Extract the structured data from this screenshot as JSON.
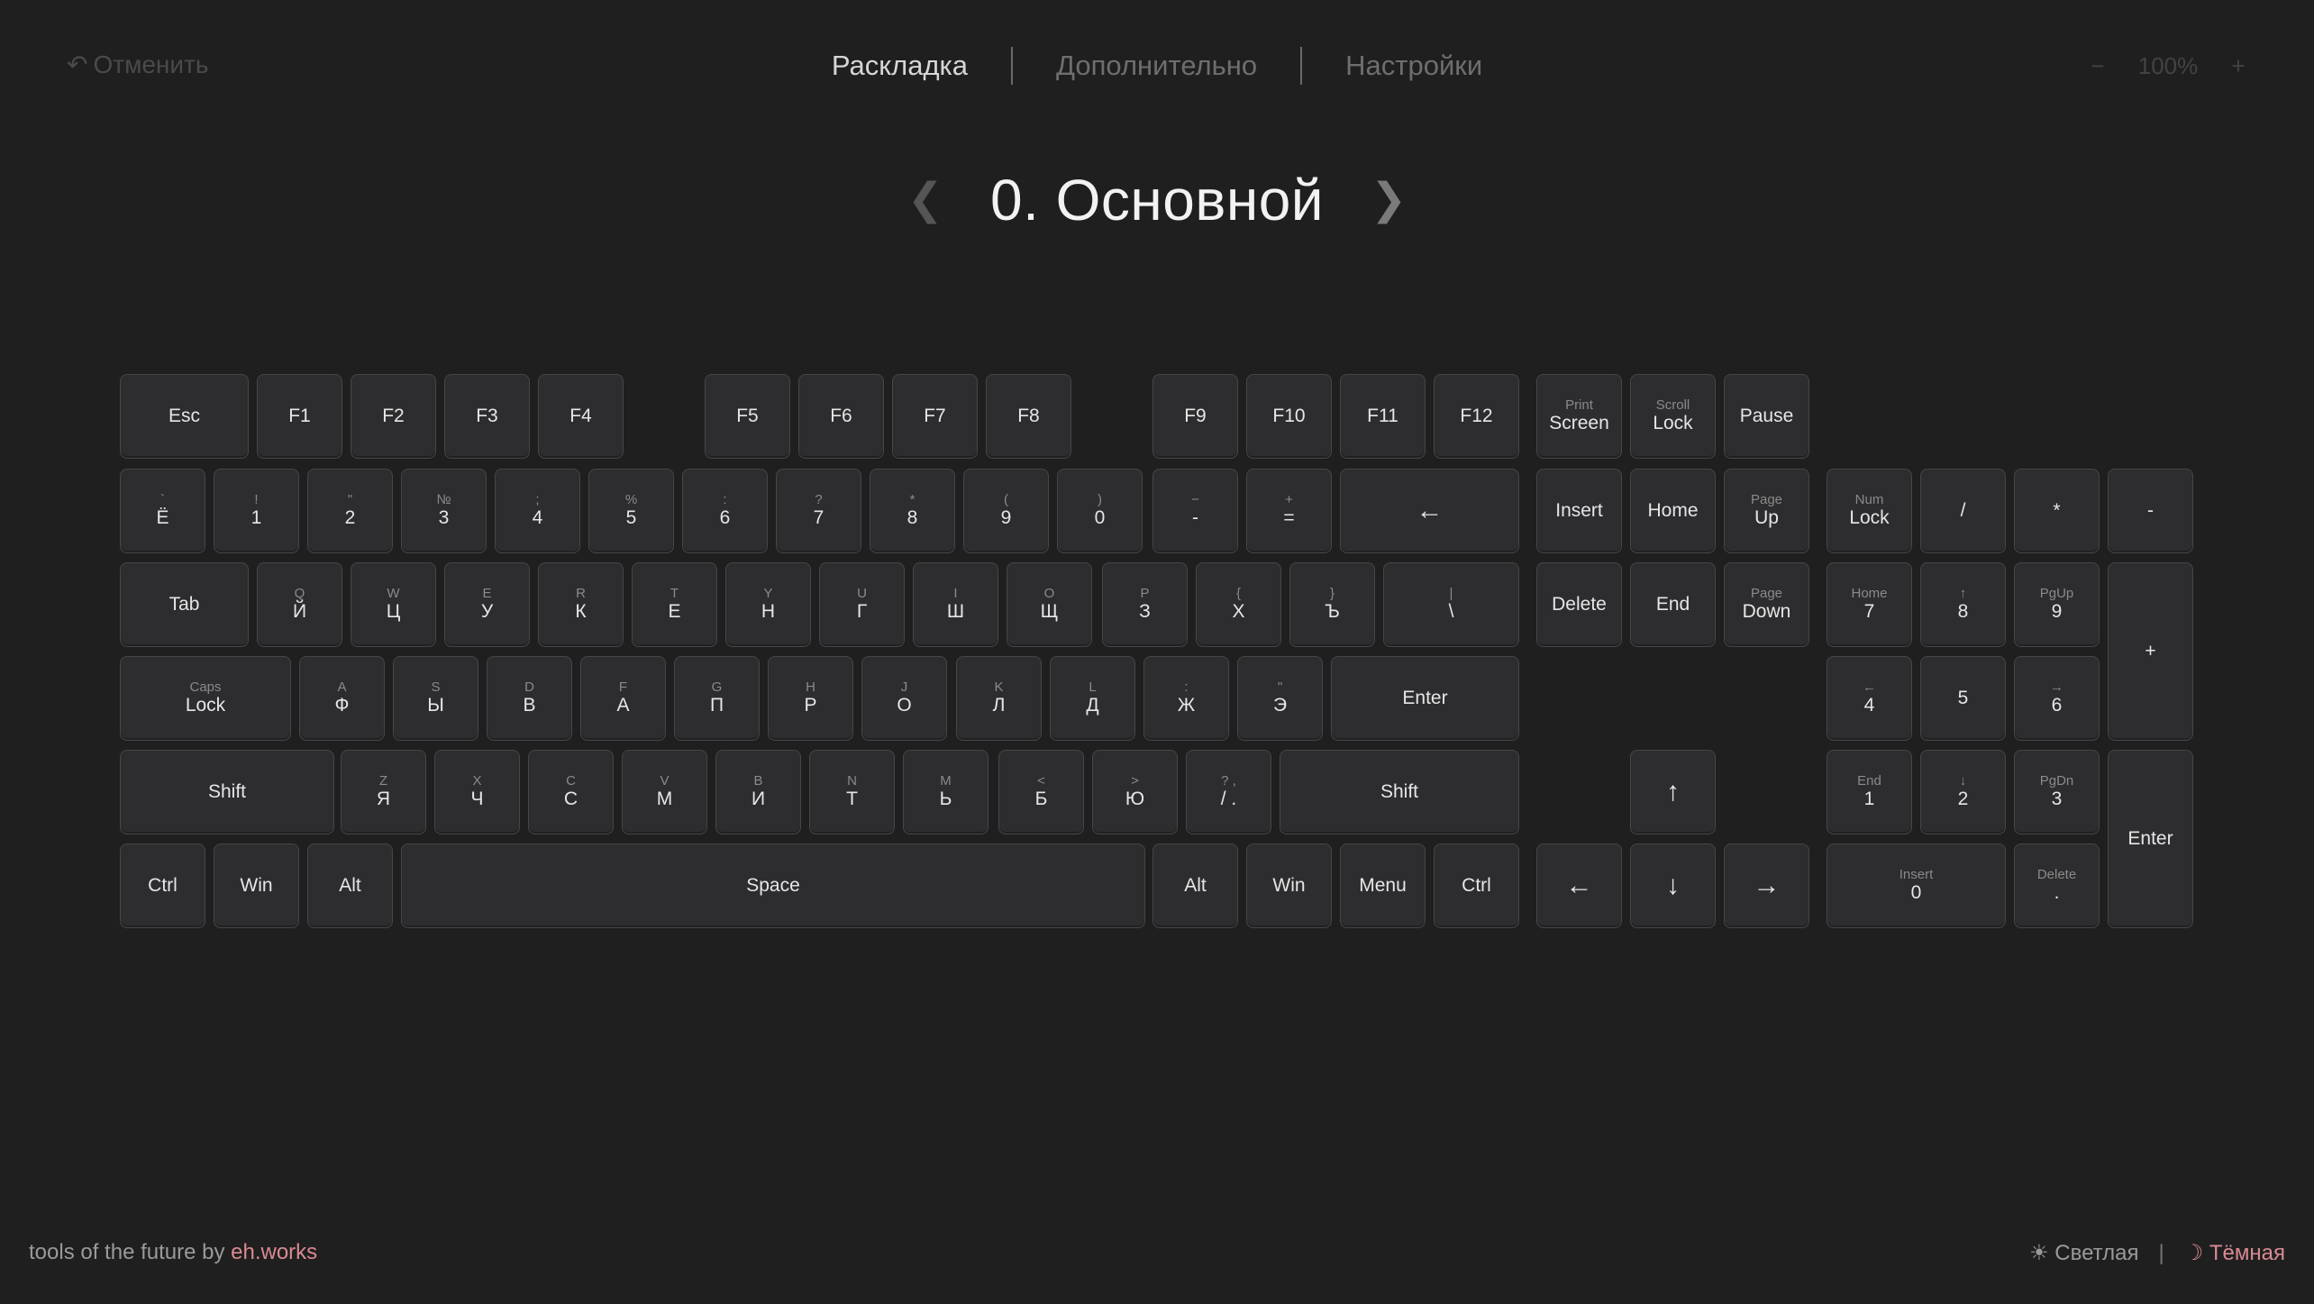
{
  "header": {
    "undo_label": "Отменить",
    "tabs": [
      {
        "label": "Раскладка",
        "active": true
      },
      {
        "label": "Дополнительно",
        "active": false
      },
      {
        "label": "Настройки",
        "active": false
      }
    ],
    "zoom_minus": "−",
    "zoom_value": "100%",
    "zoom_plus": "+"
  },
  "layer": {
    "prev": "❮",
    "title": "0. Основной",
    "next": "❯"
  },
  "keys": {
    "esc": "Esc",
    "f1": "F1",
    "f2": "F2",
    "f3": "F3",
    "f4": "F4",
    "f5": "F5",
    "f6": "F6",
    "f7": "F7",
    "f8": "F8",
    "f9": "F9",
    "f10": "F10",
    "f11": "F11",
    "f12": "F12",
    "prtsc_top": "Print",
    "prtsc_bottom": "Screen",
    "scrlk_top": "Scroll",
    "scrlk_bottom": "Lock",
    "pause": "Pause",
    "grave_top": "`",
    "grave": "Ё",
    "d1_top": "!",
    "d1": "1",
    "d2_top": "\"",
    "d2": "2",
    "d3_top": "№",
    "d3": "3",
    "d4_top": ";",
    "d4": "4",
    "d5_top": "%",
    "d5": "5",
    "d6_top": ":",
    "d6": "6",
    "d7_top": "?",
    "d7": "7",
    "d8_top": "*",
    "d8": "8",
    "d9_top": "(",
    "d9": "9",
    "d0_top": ")",
    "d0": "0",
    "minus_top": "−",
    "minus": "-",
    "equal_top": "+",
    "equal": "=",
    "backspace": "←",
    "insert": "Insert",
    "home": "Home",
    "pgup_top": "Page",
    "pgup_bottom": "Up",
    "numlock_top": "Num",
    "numlock_bottom": "Lock",
    "np_slash": "/",
    "np_star": "*",
    "np_minus": "-",
    "tab": "Tab",
    "q_top": "Q",
    "q": "Й",
    "w_top": "W",
    "w": "Ц",
    "e_top": "E",
    "e": "У",
    "r_top": "R",
    "r": "К",
    "t_top": "T",
    "t": "Е",
    "y_top": "Y",
    "y": "Н",
    "u_top": "U",
    "u": "Г",
    "i_top": "I",
    "i": "Ш",
    "o_top": "O",
    "o": "Щ",
    "p_top": "P",
    "p": "З",
    "lbr_top": "{",
    "lbr": "Х",
    "rbr_top": "}",
    "rbr": "Ъ",
    "bsl_top": "|",
    "bsl": "\\",
    "delete": "Delete",
    "end": "End",
    "pgdn_top": "Page",
    "pgdn_bottom": "Down",
    "np7_top": "Home",
    "np7": "7",
    "np8_top": "↑",
    "np8": "8",
    "np9_top": "PgUp",
    "np9": "9",
    "np_plus": "+",
    "caps_top": "Caps",
    "caps_bottom": "Lock",
    "a_top": "A",
    "a": "Ф",
    "s_top": "S",
    "s": "Ы",
    "d_top": "D",
    "d": "В",
    "f_top": "F",
    "f": "А",
    "g_top": "G",
    "g": "П",
    "h_top": "H",
    "h": "Р",
    "j_top": "J",
    "j": "О",
    "k_top": "K",
    "k": "Л",
    "l_top": "L",
    "l": "Д",
    "semi_top": ":",
    "semi": "Ж",
    "quote_top": "\"",
    "quote": "Э",
    "enter": "Enter",
    "np4_top": "←",
    "np4": "4",
    "np5": "5",
    "np6_top": "→",
    "np6": "6",
    "lshift": "Shift",
    "z_top": "Z",
    "z": "Я",
    "x_top": "X",
    "x": "Ч",
    "c_top": "C",
    "c": "С",
    "v_top": "V",
    "v": "М",
    "b_top": "B",
    "b": "И",
    "n_top": "N",
    "n": "Т",
    "m_top": "M",
    "m": "Ь",
    "comma_top": "<",
    "comma": "Б",
    "period_top": ">",
    "period": "Ю",
    "slash_top": "?  ,",
    "slash": "/  .",
    "rshift": "Shift",
    "up": "↑",
    "np1_top": "End",
    "np1": "1",
    "np2_top": "↓",
    "np2": "2",
    "np3_top": "PgDn",
    "np3": "3",
    "np_enter": "Enter",
    "lctrl": "Ctrl",
    "lwin": "Win",
    "lalt": "Alt",
    "space": "Space",
    "ralt": "Alt",
    "rwin": "Win",
    "menu": "Menu",
    "rctrl": "Ctrl",
    "left": "←",
    "down": "↓",
    "right": "→",
    "np0_top": "Insert",
    "np0": "0",
    "npdot_top": "Delete",
    "npdot": "."
  },
  "footer": {
    "prefix": "tools of the future by ",
    "brand": "eh.works",
    "light_icon": "☀",
    "light_label": "Светлая",
    "sep": "|",
    "dark_icon": "☽",
    "dark_label": "Тёмная"
  },
  "colors": {
    "background": "#1f1f1f",
    "key_fill": "#2d2d30",
    "key_border": "#464649",
    "accent": "#d98a92"
  }
}
